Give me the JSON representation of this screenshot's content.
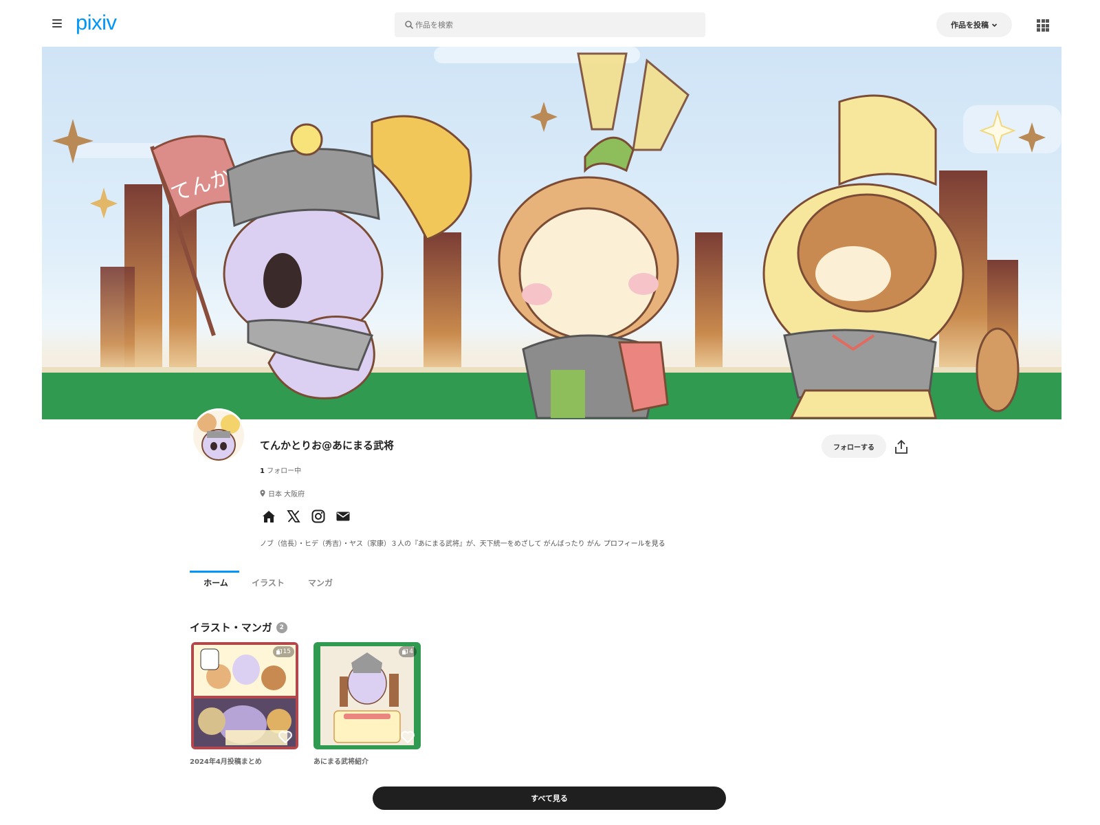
{
  "header": {
    "logo": "pixiv",
    "search_placeholder": "作品を検索",
    "post_button": "作品を投稿"
  },
  "profile": {
    "name": "てんかとりお@あにまる武将",
    "following_count": "1",
    "following_label": "フォロー中",
    "location": "日本 大阪府",
    "bio": "ノブ（信長）・ヒデ（秀吉）・ヤス（家康）３人の『あにまる武将』が、天下統一をめざして がんばったり がん",
    "bio_more": "プロフィールを見る",
    "follow_button": "フォローする",
    "social_icons": [
      "home-icon",
      "x-icon",
      "instagram-icon",
      "mail-icon"
    ]
  },
  "cover": {
    "flag_text": "てんか"
  },
  "tabs": [
    {
      "label": "ホーム",
      "active": true
    },
    {
      "label": "イラスト",
      "active": false
    },
    {
      "label": "マンガ",
      "active": false
    }
  ],
  "works_section": {
    "title": "イラスト・マンガ",
    "count": "2",
    "works": [
      {
        "title": "2024年4月投稿まとめ",
        "pages": "15"
      },
      {
        "title": "あにまる武将紹介",
        "pages": "4"
      }
    ]
  },
  "see_all_button": "すべて見る",
  "colors": {
    "accent": "#0096fa",
    "dark_button": "#1f1f1f",
    "cover_grass": "#2f9a50",
    "cover_sky": "#cfe4f6"
  }
}
